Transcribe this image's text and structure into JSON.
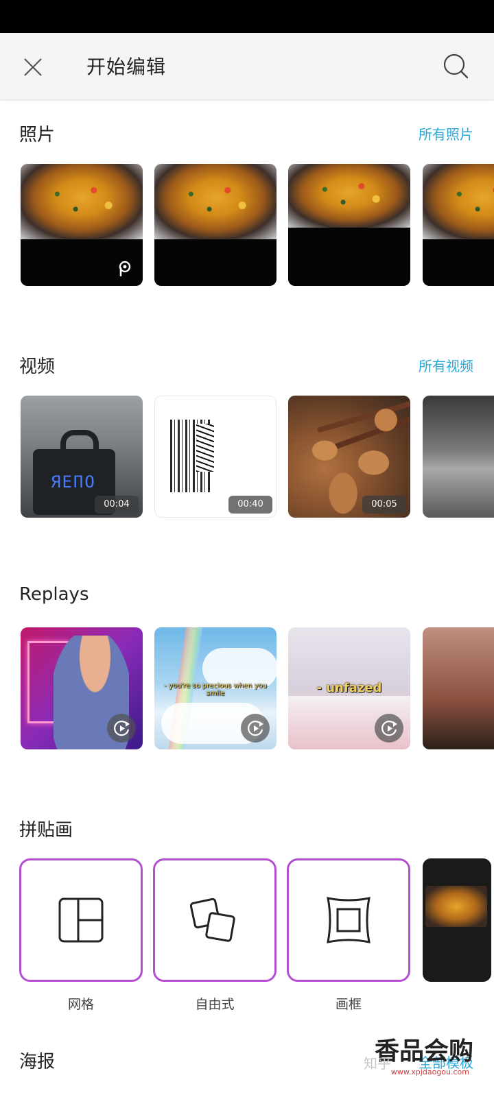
{
  "header": {
    "title": "开始编辑"
  },
  "photos": {
    "section_title": "照片",
    "see_all": "所有照片"
  },
  "videos": {
    "section_title": "视频",
    "see_all": "所有视频",
    "items": [
      {
        "duration": "00:04"
      },
      {
        "duration": "00:40"
      },
      {
        "duration": "00:05"
      },
      {
        "duration": ""
      }
    ]
  },
  "replays": {
    "section_title": "Replays",
    "items": [
      {
        "caption": ""
      },
      {
        "caption": "- you're so precious when you smile"
      },
      {
        "caption": "- unfazed"
      },
      {
        "caption": ""
      }
    ]
  },
  "collage": {
    "section_title": "拼贴画",
    "items": [
      {
        "label": "网格",
        "icon": "grid-icon"
      },
      {
        "label": "自由式",
        "icon": "freestyle-icon"
      },
      {
        "label": "画框",
        "icon": "frame-icon"
      }
    ]
  },
  "poster": {
    "section_title": "海报",
    "see_all": "全部模板"
  },
  "watermark": {
    "text": "知乎",
    "logo_text": "香品会购",
    "url": "www.xpjdaogou.com"
  },
  "colors": {
    "accent_link": "#2aa7d8",
    "collage_border": "#b24fd0",
    "status_bar": "#000000"
  }
}
